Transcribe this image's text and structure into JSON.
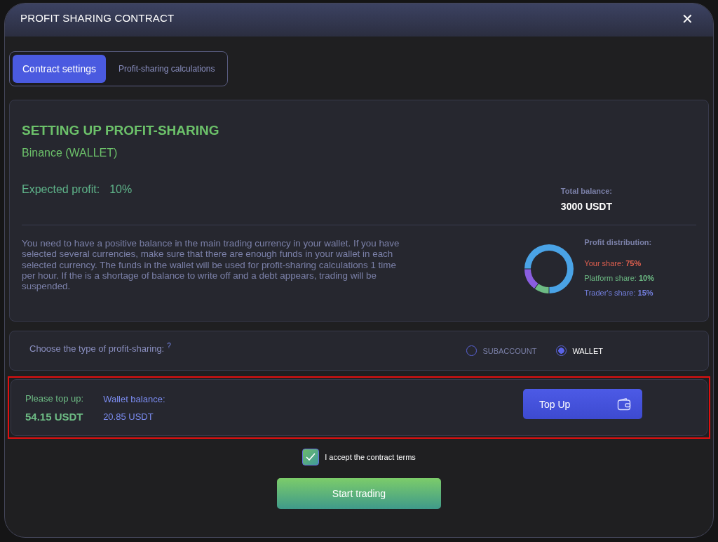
{
  "window": {
    "title": "PROFIT SHARING CONTRACT",
    "close": "✕"
  },
  "tabs": [
    {
      "label": "Contract settings",
      "selected": true
    },
    {
      "label": "Profit-sharing calculations",
      "selected": false
    }
  ],
  "settings": {
    "heading": "SETTING UP PROFIT-SHARING",
    "exchange": "Binance (WALLET)",
    "expected_profit_label": "Expected profit:",
    "expected_profit_value": "10%",
    "total_balance_label": "Total balance:",
    "total_balance_value": "3000 USDT",
    "notice": "You need to have a positive balance in the main trading currency in your wallet. If you have selected several currencies, make sure that there are enough funds in your wallet in each selected currency. The funds in the wallet will be used for profit-sharing calculations 1 time per hour. If the is a shortage of balance to write off and a debt appears, trading will be suspended.",
    "distribution_title": "Profit distribution:",
    "shares": [
      {
        "text": "Your share: **75%**",
        "color": "#e0604f"
      },
      {
        "text": "Platform share: **10%**",
        "color": "#6dbb84"
      },
      {
        "text": "Trader's share: **15%**",
        "color": "#7480e0"
      }
    ],
    "chart_data": {
      "type": "donut",
      "series": [
        {
          "values": [
            75,
            10,
            15
          ]
        }
      ],
      "colors": [
        "#4aa3e6",
        "#6dbb84",
        "#8a5ee0"
      ]
    }
  },
  "type_choice": {
    "label": "Choose the type of profit-sharing:",
    "help": "?",
    "options": [
      {
        "label": "SUBACCOUNT",
        "selected": false
      },
      {
        "label": "WALLET",
        "selected": true
      }
    ]
  },
  "top_up": {
    "highlighted": true,
    "please_label": "Please top up:",
    "please_value": "54.15 USDT",
    "wallet_label": "Wallet balance:",
    "wallet_value": "20.85 USDT",
    "button": "Top Up"
  },
  "accept": {
    "label": "I accept the contract terms",
    "checked": true
  },
  "start_button": "Start trading"
}
